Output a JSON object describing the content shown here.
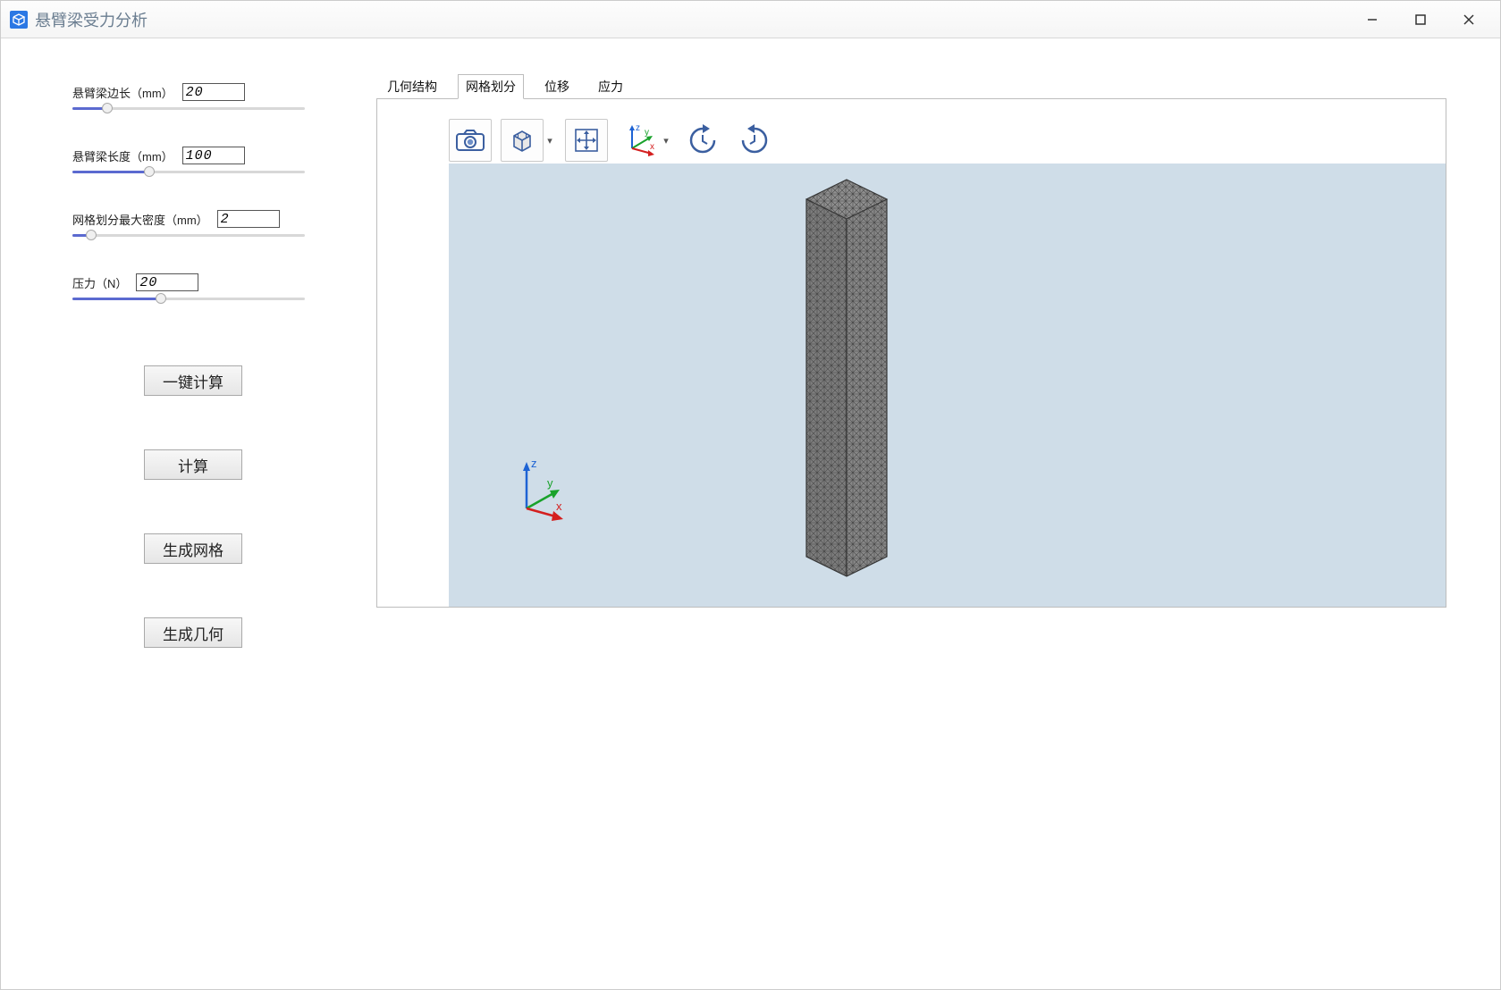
{
  "window": {
    "title": "悬臂梁受力分析"
  },
  "params": {
    "edge": {
      "label": "悬臂梁边长（mm）",
      "value": "20",
      "fill_pct": 15
    },
    "length": {
      "label": "悬臂梁长度（mm）",
      "value": "100",
      "fill_pct": 33
    },
    "mesh": {
      "label": "网格划分最大密度（mm）",
      "value": "2",
      "fill_pct": 8
    },
    "force": {
      "label": "压力（N）",
      "value": "20",
      "fill_pct": 38
    }
  },
  "buttons": {
    "one_click_calc": "一键计算",
    "calc": "计算",
    "gen_mesh": "生成网格",
    "gen_geom": "生成几何"
  },
  "tabs": {
    "geometry": "几何结构",
    "mesh": "网格划分",
    "displacement": "位移",
    "stress": "应力",
    "active": "mesh"
  },
  "toolbar_icons": {
    "snapshot": "camera-icon",
    "view": "cube-view-icon",
    "pan": "pan-icon",
    "axes": "axes-icon",
    "rotate_cw": "rotate-cw-icon",
    "rotate_ccw": "rotate-ccw-icon"
  },
  "triad": {
    "x": "x",
    "y": "y",
    "z": "z"
  },
  "colors": {
    "accent": "#5b6ad0",
    "viewport_bg": "#cfdde8",
    "mesh": "#707070"
  }
}
